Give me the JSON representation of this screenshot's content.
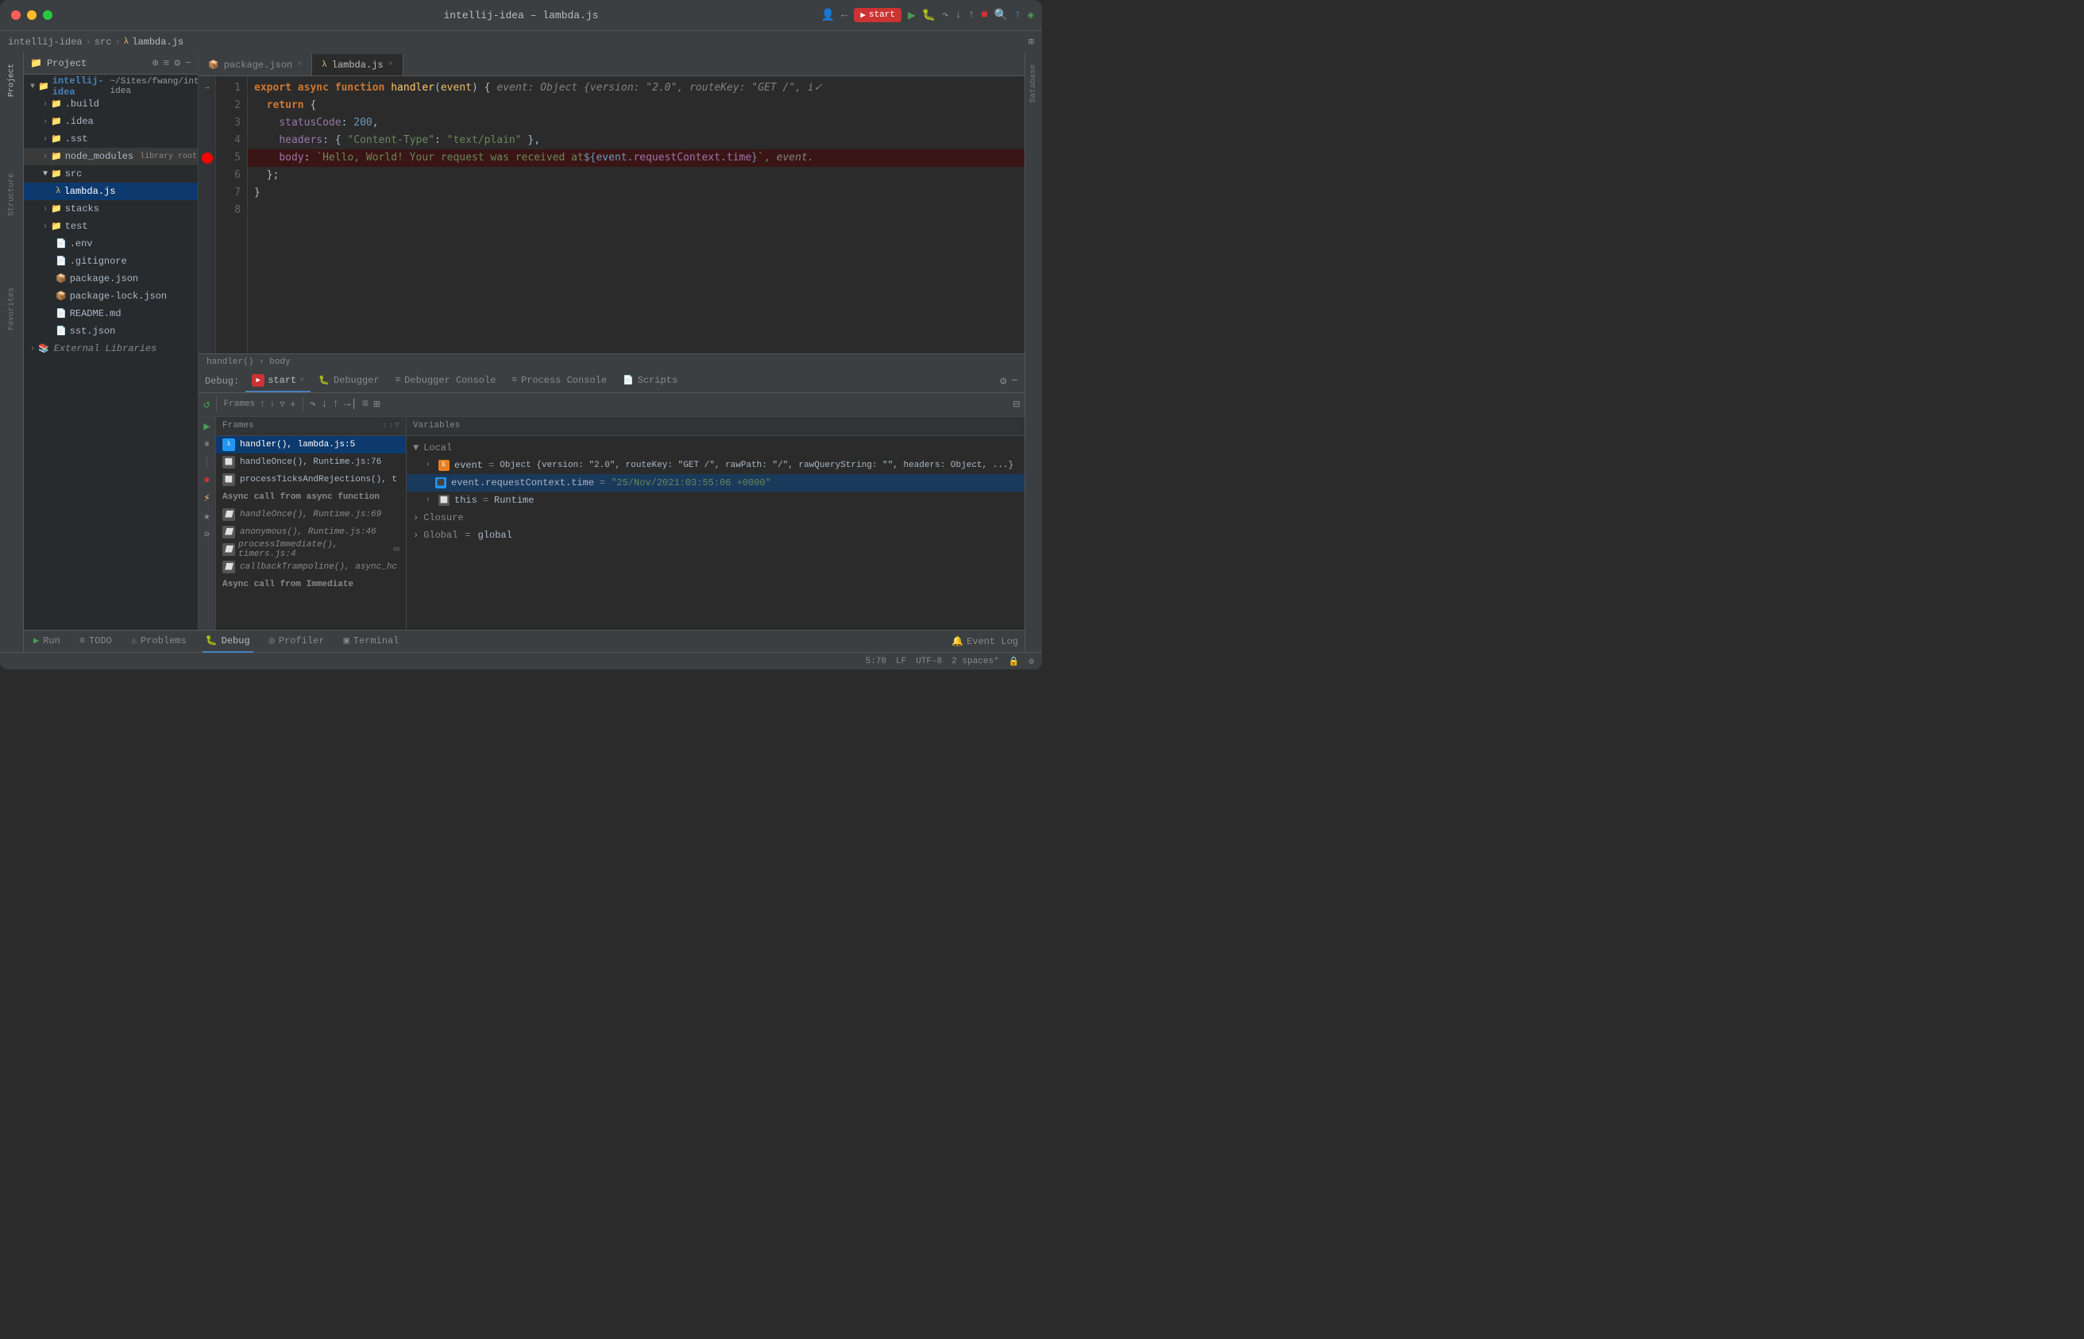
{
  "window": {
    "title": "intellij-idea – lambda.js",
    "controls": {
      "close": "●",
      "minimize": "●",
      "maximize": "●"
    }
  },
  "breadcrumb": {
    "items": [
      "intellij-idea",
      "src",
      "lambda.js"
    ]
  },
  "tabs": {
    "package_json": "package.json",
    "lambda_js": "lambda.js"
  },
  "project_panel": {
    "title": "Project",
    "root": {
      "name": "intellij-idea",
      "path": "~/Sites/fwang/intellij-idea"
    },
    "items": [
      {
        "name": ".build",
        "type": "folder",
        "level": 1
      },
      {
        "name": ".idea",
        "type": "folder",
        "level": 1
      },
      {
        "name": ".sst",
        "type": "folder",
        "level": 1
      },
      {
        "name": "node_modules",
        "type": "folder",
        "level": 1,
        "tag": "library root"
      },
      {
        "name": "src",
        "type": "folder",
        "level": 1,
        "expanded": true
      },
      {
        "name": "lambda.js",
        "type": "file",
        "level": 2,
        "selected": true
      },
      {
        "name": "stacks",
        "type": "folder",
        "level": 1
      },
      {
        "name": "test",
        "type": "folder",
        "level": 1
      },
      {
        "name": ".env",
        "type": "file",
        "level": 1
      },
      {
        "name": ".gitignore",
        "type": "file",
        "level": 1
      },
      {
        "name": "package.json",
        "type": "file",
        "level": 1
      },
      {
        "name": "package-lock.json",
        "type": "file",
        "level": 1
      },
      {
        "name": "README.md",
        "type": "file",
        "level": 1
      },
      {
        "name": "sst.json",
        "type": "file",
        "level": 1
      },
      {
        "name": "External Libraries",
        "type": "libraries",
        "level": 0
      }
    ]
  },
  "code": {
    "lines": [
      {
        "num": 1,
        "content": "export async function handler(event) {",
        "comment": "  event: Object {version: \"2.0\", routeKey: \"GET /\", i✓",
        "type": "normal"
      },
      {
        "num": 2,
        "content": "  return {",
        "type": "normal"
      },
      {
        "num": 3,
        "content": "    statusCode: 200,",
        "type": "normal"
      },
      {
        "num": 4,
        "content": "    headers: { \"Content-Type\": \"text/plain\" },",
        "type": "normal"
      },
      {
        "num": 5,
        "content": "    body: `Hello, World! Your request was received at ${event.requestContext.time}`,",
        "comment": "  event.",
        "type": "breakpoint"
      },
      {
        "num": 6,
        "content": "  };",
        "type": "normal"
      },
      {
        "num": 7,
        "content": "}",
        "type": "normal"
      },
      {
        "num": 8,
        "content": "",
        "type": "normal"
      }
    ],
    "footer": {
      "breadcrumb": "handler() › body"
    }
  },
  "debug": {
    "label": "Debug:",
    "session": "start",
    "tabs": [
      {
        "label": "Debugger",
        "icon": "🐛",
        "active": false
      },
      {
        "label": "Debugger Console",
        "icon": "≡",
        "active": false
      },
      {
        "label": "Process Console",
        "icon": "≡",
        "active": false
      },
      {
        "label": "Scripts",
        "icon": "📄",
        "active": false
      }
    ],
    "panels": {
      "frames": {
        "title": "Frames",
        "items": [
          {
            "name": "handler(), lambda.js:5",
            "selected": true,
            "type": "normal"
          },
          {
            "name": "handleOnce(), Runtime.js:76",
            "type": "normal"
          },
          {
            "name": "processTicksAndRejections(), t",
            "type": "normal"
          },
          {
            "name": "Async call from async function",
            "type": "async-label"
          },
          {
            "name": "handleOnce(), Runtime.js:69",
            "type": "italic"
          },
          {
            "name": "anonymous(), Runtime.js:46",
            "type": "italic"
          },
          {
            "name": "processImmediate(), timers.js:4",
            "type": "italic"
          },
          {
            "name": "callbackTrampoline(), async_hc",
            "type": "italic"
          },
          {
            "name": "Async call from Immediate",
            "type": "async-label"
          }
        ]
      },
      "variables": {
        "title": "Variables",
        "sections": {
          "local": {
            "label": "Local",
            "expanded": true,
            "items": [
              {
                "name": "event",
                "value": "Object {version: \"2.0\", routeKey: \"GET /\", rawPath: \"/\", rawQueryString: \"\", headers: Object, ...}",
                "type": "obj",
                "indent": 1
              },
              {
                "name": "event.requestContext.time",
                "value": "\"25/Nov/2021:03:55:06 +0000\"",
                "type": "str",
                "indent": 2,
                "highlighted": true
              },
              {
                "name": "this",
                "value": "Runtime",
                "type": "obj",
                "indent": 1
              }
            ]
          },
          "closure": {
            "label": "Closure",
            "expanded": false
          },
          "global": {
            "label": "Global",
            "value": "global",
            "expanded": false
          }
        }
      }
    }
  },
  "bottom_toolbar": {
    "tabs": [
      {
        "label": "Run",
        "icon": "▶"
      },
      {
        "label": "TODO",
        "icon": "≡"
      },
      {
        "label": "Problems",
        "icon": "⚠"
      },
      {
        "label": "Debug",
        "icon": "🐛",
        "active": true
      },
      {
        "label": "Profiler",
        "icon": "📊"
      },
      {
        "label": "Terminal",
        "icon": "▣"
      }
    ],
    "event_log": "Event Log"
  },
  "status_bar": {
    "position": "5:78",
    "line_ending": "LF",
    "encoding": "UTF-8",
    "indent": "2 spaces*",
    "lock_icon": "🔒"
  }
}
